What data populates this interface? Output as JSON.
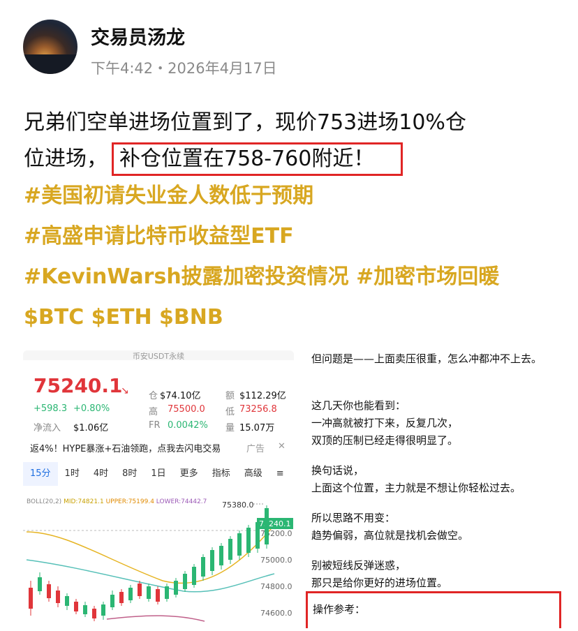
{
  "author": {
    "name": "交易员汤龙",
    "time": "下午4:42・2026年4月17日"
  },
  "post": {
    "line1": "兄弟们空单进场位置到了，现价753进场10%仓",
    "line2_prefix": "位进场，",
    "highlight": "补仓位置在758-760附近！",
    "hashtags": [
      "#美国初请失业金人数低于预期",
      "#高盛申请比特币收益型ETF",
      "#KevinWarsh披露加密投资情况 #加密市场回暖",
      "$BTC $ETH $BNB"
    ]
  },
  "left_shot": {
    "top_title": "币安USDT永续",
    "price": "75240.1",
    "change_abs": "+598.3",
    "change_pct": "+0.80%",
    "inflow_label": "净流入",
    "inflow_value": "$1.06亿",
    "oi_label": "仓",
    "oi_value": "$74.10亿",
    "vol_label": "额",
    "vol_value": "$112.29亿",
    "high_label": "高",
    "high_value": "75500.0",
    "low_label": "低",
    "low_value": "73256.8",
    "fr_label": "FR",
    "fr_value": "0.0042%",
    "qty_label": "量",
    "qty_value": "15.07万",
    "ad_text": "返4%！HYPE暴涨+石油领跑，点我去闪电交易",
    "ad_tag": "广告",
    "tabs": [
      "15分",
      "1时",
      "4时",
      "8时",
      "1日",
      "更多",
      "指标",
      "高级"
    ],
    "boll": {
      "label": "BOLL(20,2)",
      "mid": "MID:74821.1",
      "upper": "UPPER:75199.4",
      "lower": "LOWER:74442.7"
    },
    "axis_labels": [
      "75380.0",
      "75240.1",
      "75200.0",
      "75000.0",
      "74800.0",
      "74600.0"
    ],
    "colors": {
      "up": "#2bb673",
      "down": "#e0353a",
      "accent": "#1f6fe0"
    }
  },
  "right_shot": {
    "p1": "但问题是——上面卖压很重，怎么冲都冲不上去。",
    "p2a": "这几天你也能看到：",
    "p2b": "一冲高就被打下来，反复几次，",
    "p2c": "双顶的压制已经走得很明显了。",
    "p3a": "换句话说，",
    "p3b": "上面这个位置，主力就是不想让你轻松过去。",
    "p4a": "所以思路不用变：",
    "p4b": "趋势偏弱，高位就是找机会做空。",
    "p5a": "别被短线反弹迷惑，",
    "p5b": "那只是给你更好的进场位置。",
    "op": "操作参考："
  },
  "colors": {
    "hashtag": "#d8a721",
    "highlight_border": "#e02525"
  }
}
